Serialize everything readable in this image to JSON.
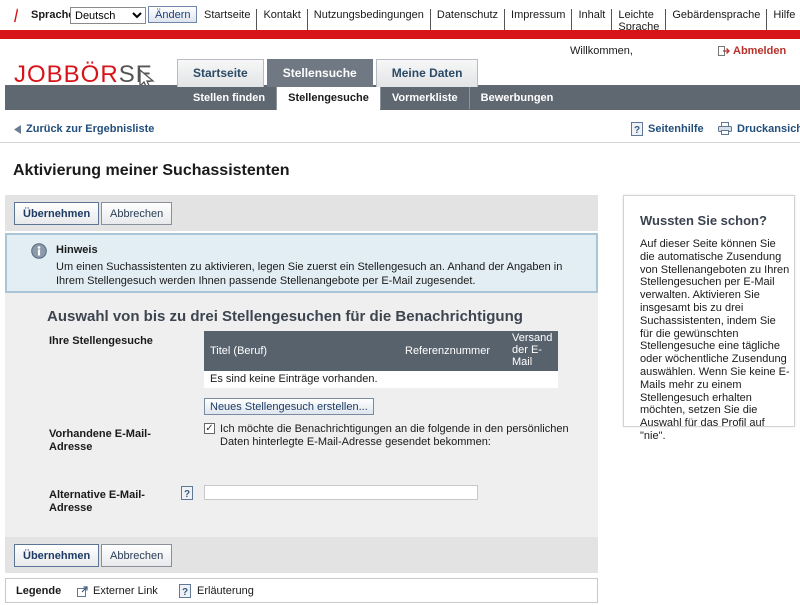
{
  "topbar": {
    "language_label": "Sprache",
    "language_value": "Deutsch",
    "change_button": "Ändern",
    "links": [
      "Startseite",
      "Kontakt",
      "Nutzungsbedingungen",
      "Datenschutz",
      "Impressum",
      "Inhalt",
      "Leichte Sprache",
      "Gebärdensprache",
      "Hilfe"
    ]
  },
  "header": {
    "logo_red": "JOBBÖR",
    "logo_gray": "SE",
    "welcome": "Willkommen,",
    "logout": "Abmelden",
    "main_tabs": [
      "Startseite",
      "Stellensuche",
      "Meine Daten"
    ],
    "sub_tabs": [
      "Stellen finden",
      "Stellengesuche",
      "Vormerkliste",
      "Bewerbungen"
    ]
  },
  "actionbar": {
    "back": "Zurück zur Ergebnisliste",
    "help": "Seitenhilfe",
    "print": "Druckansicht"
  },
  "page": {
    "title": "Aktivierung meiner Suchassistenten"
  },
  "buttons": {
    "apply": "Übernehmen",
    "cancel": "Abbrechen",
    "new_request": "Neues Stellengesuch erstellen..."
  },
  "hint": {
    "title": "Hinweis",
    "text": "Um einen Suchassistenten zu aktivieren, legen Sie zuerst ein Stellengesuch an. Anhand der Angaben in Ihrem Stellengesuch werden Ihnen passende Stellenangebote per E-Mail zugesendet."
  },
  "form": {
    "section_title": "Auswahl von bis zu drei Stellengesuchen für die Benachrichtigung",
    "requests_label": "Ihre Stellengesuche",
    "table_headers": [
      "Titel (Beruf)",
      "Referenznummer",
      "Versand der E-Mail"
    ],
    "empty_row": "Es sind keine Einträge vorhanden.",
    "existing_email_label": "Vorhandene E-Mail-Adresse",
    "checkbox_text": "Ich möchte die Benachrichtigungen an die folgende in den persönlichen Daten hinterlegte E-Mail-Adresse gesendet bekommen:",
    "checkbox_checked": true,
    "alt_email_label": "Alternative E-Mail-Adresse",
    "alt_email_value": ""
  },
  "legend": {
    "title": "Legende",
    "external_link": "Externer Link",
    "explanation": "Erläuterung"
  },
  "sidebox": {
    "title": "Wussten Sie schon?",
    "text": "Auf dieser Seite können Sie die automatische Zusendung von Stellenangeboten zu Ihren Stellengesuchen per E-Mail verwalten. Aktivieren Sie insgesamt bis zu drei Suchassistenten, indem Sie für die gewünschten Stellengesuche eine tägliche oder wöchentliche Zusendung auswählen. Wenn Sie keine E-Mails mehr zu einem Stellengesuch erhalten möchten, setzen Sie die Auswahl für das Profil auf \"nie\"."
  },
  "colors": {
    "brand_red": "#d7141a",
    "nav_gray": "#5f6771",
    "link_blue": "#234f7c",
    "hint_bg": "#e3eef4"
  }
}
